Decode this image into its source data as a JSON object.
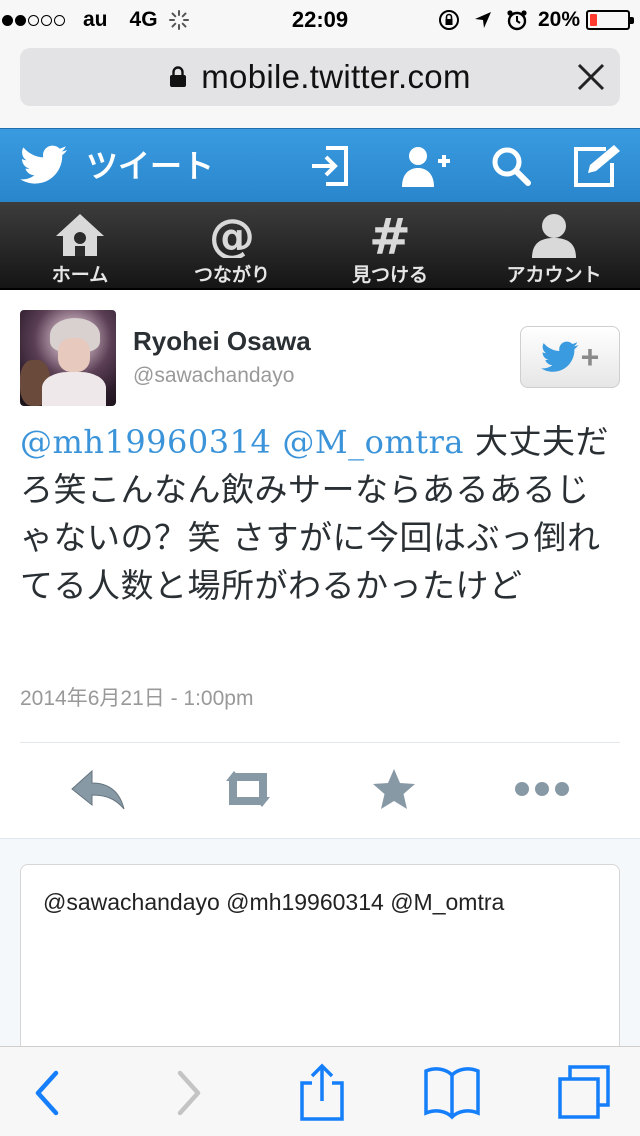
{
  "status_bar": {
    "signal_bars": [
      true,
      true,
      false,
      false,
      false
    ],
    "carrier": "au",
    "network": "4G",
    "time": "22:09",
    "battery_percent": "20%",
    "battery_level": 0.2,
    "battery_color": "#ff3b30",
    "icons": [
      "orientation-lock-icon",
      "location-arrow-icon",
      "alarm-icon"
    ]
  },
  "browser": {
    "url": "mobile.twitter.com",
    "lock_icon": "lock-icon",
    "close_icon": "close-icon"
  },
  "twitter_header": {
    "title": "ツイート",
    "accent_color": "#3a9be0",
    "actions": [
      "sign-in-icon",
      "add-user-icon",
      "search-icon",
      "compose-icon"
    ]
  },
  "nav": {
    "items": [
      {
        "label": "ホーム",
        "icon": "home-icon"
      },
      {
        "label": "つながり",
        "icon": "at-icon"
      },
      {
        "label": "見つける",
        "icon": "hashtag-icon"
      },
      {
        "label": "アカウント",
        "icon": "person-icon"
      }
    ]
  },
  "tweet": {
    "user_name": "Ryohei Osawa",
    "user_handle": "@sawachandayo",
    "mentions": [
      "@mh19960314",
      "@M_omtra"
    ],
    "body": "大丈夫だろ笑こんなん飲みサーならあるあるじゃないの？笑 さすがに今回はぶっ倒れてる人数と場所がわるかったけど",
    "timestamp": "2014年6月21日 - 1:00pm",
    "mention_color": "#3b94d9",
    "actions": [
      "reply-icon",
      "retweet-icon",
      "favorite-star-icon",
      "more-dots-icon"
    ]
  },
  "reply": {
    "text": "@sawachandayo @mh19960314 @M_omtra"
  },
  "safari_toolbar": {
    "buttons": [
      "back-chevron-icon",
      "forward-chevron-icon",
      "share-icon",
      "bookmarks-icon",
      "tabs-icon"
    ],
    "accent_color": "#147efb"
  }
}
